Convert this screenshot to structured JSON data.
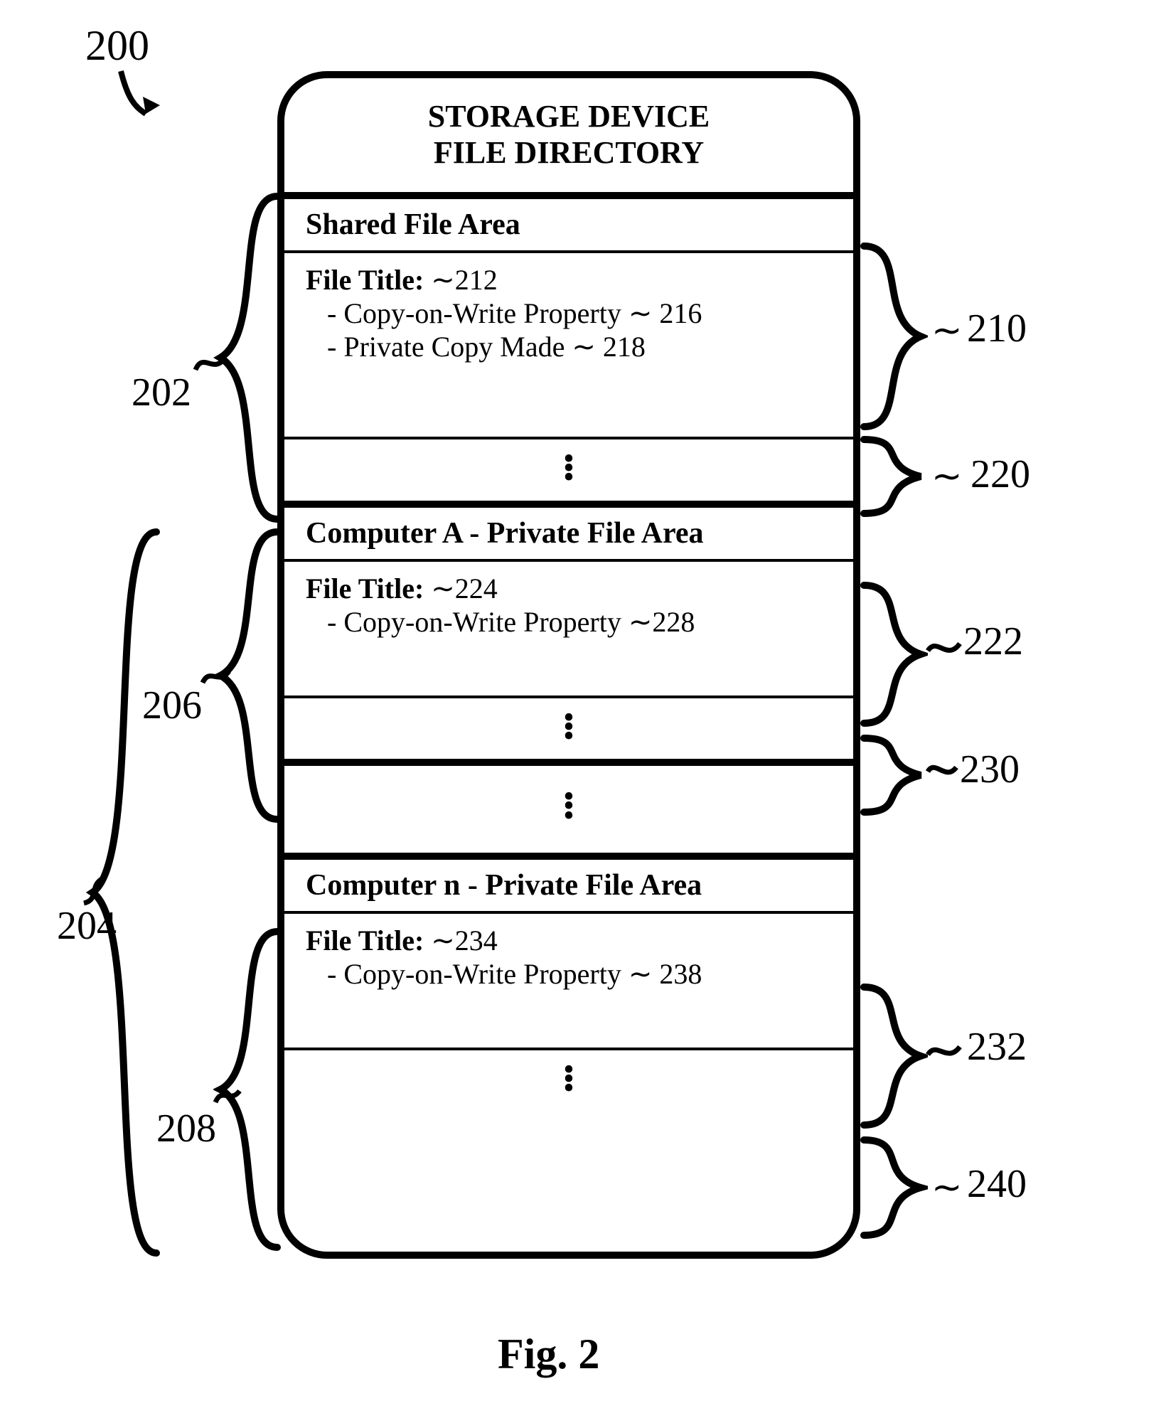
{
  "figure_label": "Fig. 2",
  "top_ref": "200",
  "device": {
    "title_line1": "STORAGE DEVICE",
    "title_line2": "FILE DIRECTORY"
  },
  "sections": {
    "shared": {
      "header": "Shared File Area",
      "file_title_label": "File Title:",
      "file_title_ref": "212",
      "prop1": "- Copy-on-Write Property",
      "prop1_ref": "216",
      "prop2": "- Private Copy Made",
      "prop2_ref": "218"
    },
    "compA": {
      "header": "Computer A - Private File Area",
      "file_title_label": "File Title:",
      "file_title_ref": "224",
      "prop1": "- Copy-on-Write Property",
      "prop1_ref": "228"
    },
    "compN": {
      "header": "Computer n - Private File Area",
      "file_title_label": "File Title:",
      "file_title_ref": "234",
      "prop1": "- Copy-on-Write Property",
      "prop1_ref": "238"
    }
  },
  "left_refs": {
    "shared_area": "202",
    "private_group": "204",
    "compA_area": "206",
    "compN_area": "208"
  },
  "right_refs": {
    "shared_entry": "210",
    "shared_more": "220",
    "compA_entry": "222",
    "compA_more": "230",
    "compN_entry": "232",
    "compN_more": "240"
  }
}
